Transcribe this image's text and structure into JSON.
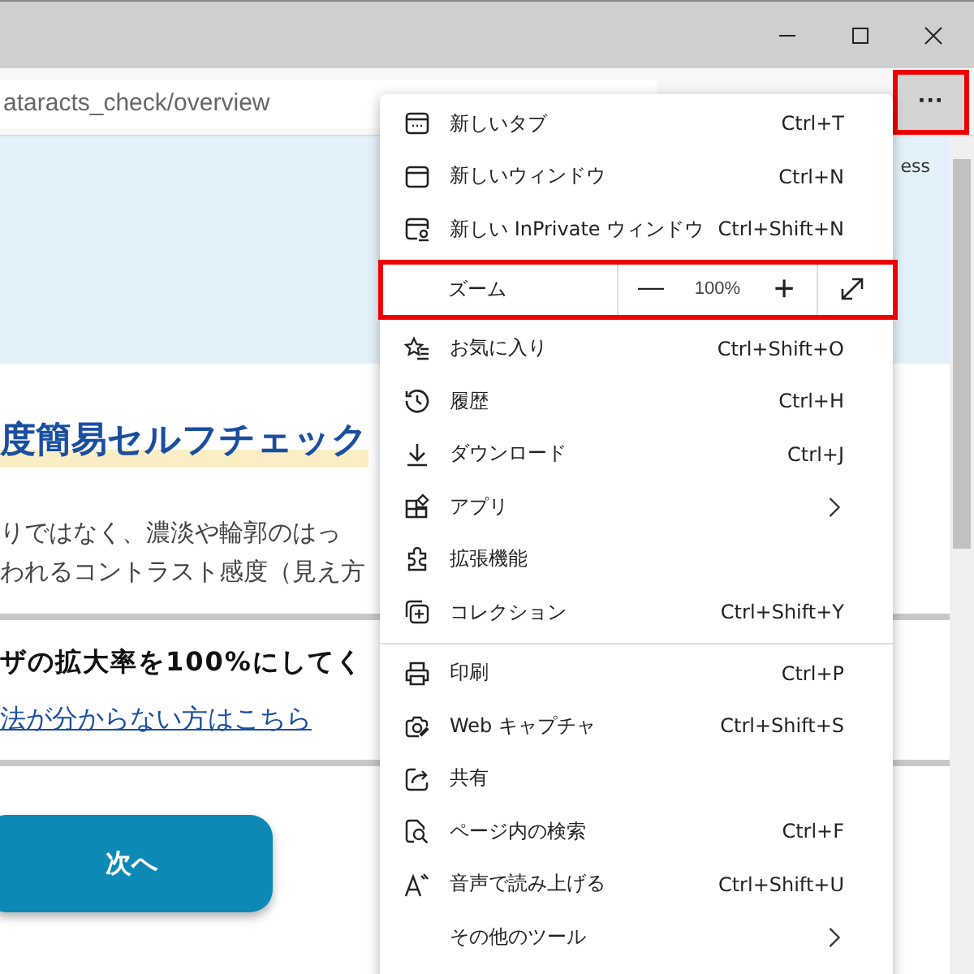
{
  "address_bar": {
    "value": "ataracts_check/overview"
  },
  "more_button": {
    "label": "···",
    "highlighted": true
  },
  "page": {
    "side_text": "ess",
    "heading": "度簡易セルフチェック",
    "paragraph_lines": [
      "りではなく、濃淡や輪郭のはっ",
      "われるコントラスト感度（見え方"
    ],
    "instruction": "ザの拡大率を100%にして",
    "instruction_tail": "く",
    "help_link": "法が分からない方はこちら",
    "next_button": "次へ"
  },
  "menu_items": [
    {
      "kind": "item",
      "label": "新しいタブ",
      "shortcut": "Ctrl+T"
    },
    {
      "kind": "item",
      "label": "新しいウィンドウ",
      "shortcut": "Ctrl+N"
    },
    {
      "kind": "item",
      "label": "新しい InPrivate ウィンドウ",
      "shortcut": "Ctrl+Shift+N"
    },
    {
      "kind": "zoom",
      "label": "ズーム",
      "minus": "—",
      "value": "100%",
      "plus": "+",
      "highlighted": true
    },
    {
      "kind": "item",
      "label": "お気に入り",
      "shortcut": "Ctrl+Shift+O"
    },
    {
      "kind": "item",
      "label": "履歴",
      "shortcut": "Ctrl+H"
    },
    {
      "kind": "item",
      "label": "ダウンロード",
      "shortcut": "Ctrl+J"
    },
    {
      "kind": "item",
      "label": "アプリ",
      "submenu": true
    },
    {
      "kind": "item",
      "label": "拡張機能"
    },
    {
      "kind": "item",
      "label": "コレクション",
      "shortcut": "Ctrl+Shift+Y"
    },
    {
      "kind": "divider"
    },
    {
      "kind": "item",
      "label": "印刷",
      "shortcut": "Ctrl+P"
    },
    {
      "kind": "item",
      "label": "Web キャプチャ",
      "shortcut": "Ctrl+Shift+S"
    },
    {
      "kind": "item",
      "label": "共有"
    },
    {
      "kind": "item",
      "label": "ページ内の検索",
      "shortcut": "Ctrl+F"
    },
    {
      "kind": "item",
      "label": "音声で読み上げる",
      "shortcut": "Ctrl+Shift+U"
    },
    {
      "kind": "item",
      "label": "その他のツール",
      "submenu": true
    }
  ]
}
